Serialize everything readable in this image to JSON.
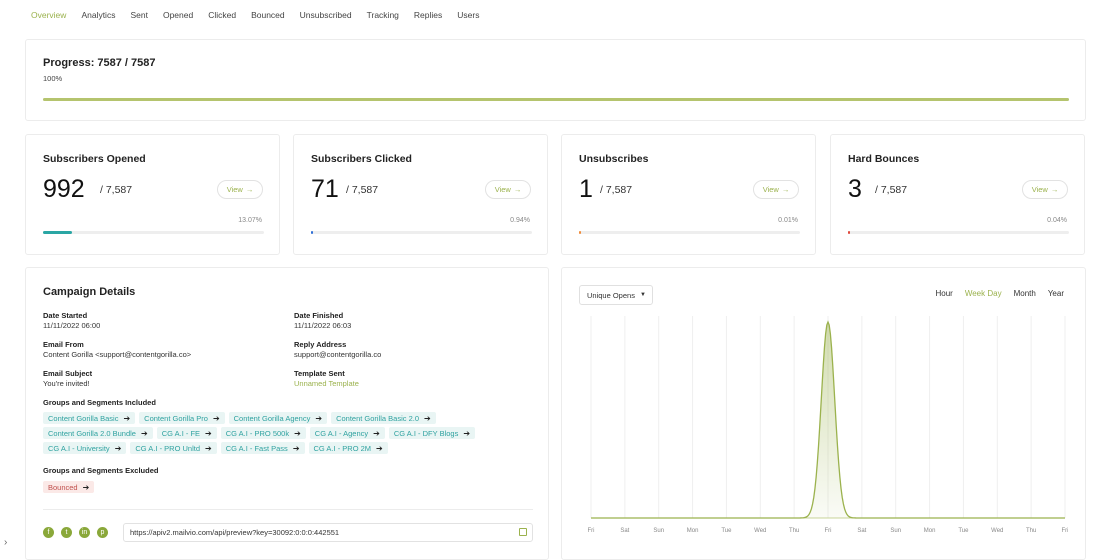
{
  "tabs": [
    "Overview",
    "Analytics",
    "Sent",
    "Opened",
    "Clicked",
    "Bounced",
    "Unsubscribed",
    "Tracking",
    "Replies",
    "Users"
  ],
  "progress": {
    "title": "Progress: 7587 / 7587",
    "percent_text": "100%",
    "fraction": 1.0
  },
  "stats": [
    {
      "title": "Subscribers Opened",
      "value": "992",
      "total": "/ 7,587",
      "percent": "13.07%",
      "fraction": 0.1307,
      "color": "#2aa6a4",
      "view": "View"
    },
    {
      "title": "Subscribers Clicked",
      "value": "71",
      "total": "/ 7,587",
      "percent": "0.94%",
      "fraction": 0.0094,
      "color": "#2f6fd6",
      "view": "View"
    },
    {
      "title": "Unsubscribes",
      "value": "1",
      "total": "/ 7,587",
      "percent": "0.01%",
      "fraction": 0.0001,
      "color": "#f08c3a",
      "view": "View"
    },
    {
      "title": "Hard Bounces",
      "value": "3",
      "total": "/ 7,587",
      "percent": "0.04%",
      "fraction": 0.0004,
      "color": "#e0483b",
      "view": "View"
    }
  ],
  "details": {
    "title": "Campaign Details",
    "date_started_label": "Date Started",
    "date_started": "11/11/2022 06:00",
    "date_finished_label": "Date Finished",
    "date_finished": "11/11/2022 06:03",
    "email_from_label": "Email From",
    "email_from": "Content Gorilla <support@contentgorilla.co>",
    "reply_label": "Reply Address",
    "reply": "support@contentgorilla.co",
    "subject_label": "Email Subject",
    "subject": "You're invited!",
    "template_label": "Template Sent",
    "template": "Unnamed Template",
    "included_label": "Groups and Segments Included",
    "included_rows": [
      [
        "Content Gorilla Basic",
        "Content Gorilla Pro",
        "Content Gorilla Agency",
        "Content Gorilla Basic 2.0"
      ],
      [
        "Content Gorilla 2.0 Bundle",
        "CG A.I - FE",
        "CG A.I - PRO 500k",
        "CG A.I - Agency",
        "CG A.I - DFY Blogs"
      ],
      [
        "CG A.I - University",
        "CG A.I - PRO Unltd",
        "CG A.I - Fast Pass",
        "CG A.I - PRO 2M"
      ]
    ],
    "excluded_label": "Groups and Segments Excluded",
    "excluded": [
      "Bounced"
    ],
    "url": "https://apiv2.mailvio.com/api/preview?key=30092:0:0:0:442551"
  },
  "chart_controls": {
    "dropdown": "Unique Opens",
    "ranges": [
      "Hour",
      "Week Day",
      "Month",
      "Year"
    ],
    "active_range": "Week Day"
  },
  "chart_data": {
    "type": "area",
    "x": [
      "Fri",
      "Sat",
      "Sun",
      "Mon",
      "Tue",
      "Wed",
      "Thu",
      "Fri",
      "Sat",
      "Sun",
      "Mon",
      "Tue",
      "Wed",
      "Thu",
      "Fri"
    ],
    "values": [
      0,
      0,
      0,
      0,
      0,
      0,
      0,
      992,
      0,
      0,
      0,
      0,
      0,
      0,
      0
    ],
    "ylim": [
      0,
      992
    ],
    "grid": true,
    "color": "#9bb24d"
  }
}
